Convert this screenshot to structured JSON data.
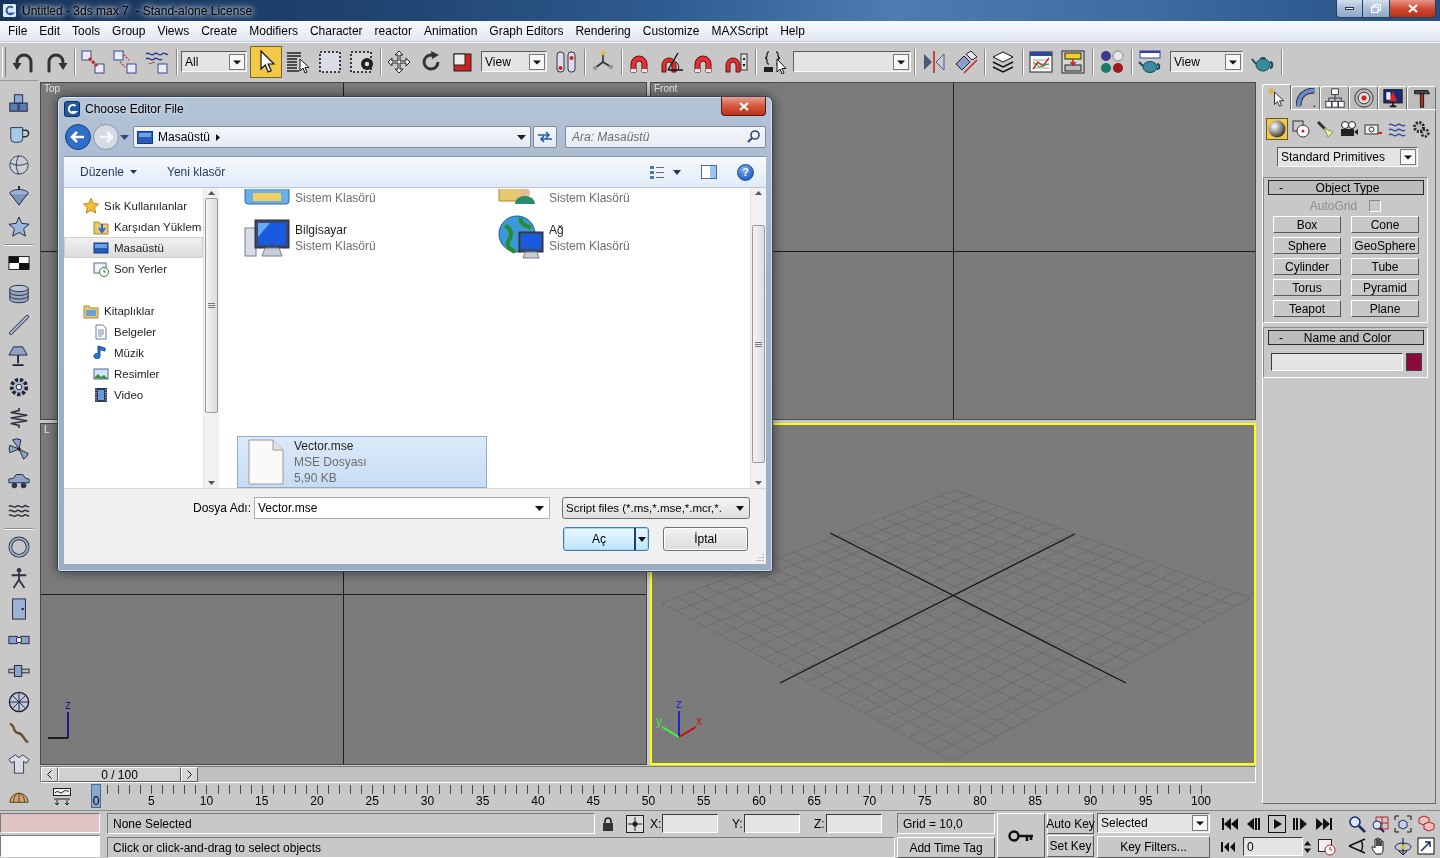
{
  "window": {
    "title": "Untitled - 3ds max 7  - Stand-alone License"
  },
  "menu": [
    "File",
    "Edit",
    "Tools",
    "Group",
    "Views",
    "Create",
    "Modifiers",
    "Character",
    "reactor",
    "Animation",
    "Graph Editors",
    "Rendering",
    "Customize",
    "MAXScript",
    "Help"
  ],
  "main_toolbar": {
    "selection_filter": "All",
    "select_object": {
      "active": true
    },
    "reference_coordinate_system": "View",
    "render_type": "View"
  },
  "viewports": [
    {
      "kind": "ortho",
      "label": "Top",
      "active": false
    },
    {
      "kind": "ortho",
      "label": "Front",
      "active": false
    },
    {
      "kind": "ortho",
      "label": "L",
      "active": false,
      "axes": [
        {
          "kind": "up",
          "label": "z",
          "color": "#1a1a8c"
        },
        {
          "kind": "left",
          "color": "#1e1e1e"
        }
      ]
    },
    {
      "kind": "perspective",
      "active": true,
      "axes": [
        {
          "kind": "up",
          "label": "z",
          "color": "#2222c8"
        },
        {
          "kind": "left",
          "label": "y",
          "color": "#3cf03c"
        },
        {
          "kind": "right",
          "label": "x",
          "color": "#c81414"
        }
      ]
    }
  ],
  "time_slider": {
    "label": "0 / 100",
    "level": 0
  },
  "track_bar": {
    "frames": [
      "0",
      "5",
      "10",
      "15",
      "20",
      "25",
      "30",
      "35",
      "40",
      "45",
      "50",
      "55",
      "60",
      "65",
      "70",
      "75",
      "80",
      "85",
      "90",
      "95",
      "100"
    ]
  },
  "command_panel": {
    "tabs": [
      {
        "selected": true
      },
      {
        "selected": false
      },
      {
        "selected": false
      },
      {
        "selected": false
      },
      {
        "selected": false
      },
      {
        "selected": false
      }
    ],
    "categories": [
      {
        "selected": true
      },
      {
        "selected": false
      },
      {
        "selected": false
      },
      {
        "selected": false
      },
      {
        "selected": false
      },
      {
        "selected": false
      },
      {
        "selected": false
      }
    ],
    "object_category": "Standard Primitives",
    "rollouts": [
      {
        "kind": "object_type",
        "title": "Object Type",
        "toggle": "-",
        "autogrid": {
          "label": "AutoGrid",
          "checked": false,
          "disabled": true
        },
        "buttons": [
          "Box",
          "Cone",
          "Sphere",
          "GeoSphere",
          "Cylinder",
          "Tube",
          "Torus",
          "Pyramid",
          "Teapot",
          "Plane"
        ]
      },
      {
        "kind": "name_color",
        "title": "Name and Color",
        "toggle": "-",
        "color": "#8a0a3c"
      }
    ]
  },
  "status_bar": {
    "selection": "None Selected",
    "coordinates": [
      "X:",
      "Y:",
      "Z:"
    ],
    "grid": "Grid = 10,0",
    "prompt": "Click or click-and-drag to select objects",
    "time_tag": "Add Time Tag",
    "auto_key": {
      "label": "Auto Key",
      "on": false
    },
    "set_key": "Set Key",
    "key_set": "Selected",
    "key_filters": "Key Filters...",
    "current_frame": "0"
  },
  "dialog": {
    "title": "Choose Editor File",
    "location": "Masaüstü",
    "search_placeholder": "Ara: Masaüstü",
    "commands": [
      {
        "label": "Düzenle",
        "menu": true
      },
      {
        "label": "Yeni klasör",
        "menu": false
      }
    ],
    "help": "?",
    "navigation": [
      {
        "label": "Sık Kullanılanlar",
        "kind": "favorites",
        "selected": false,
        "children": [
          {
            "label": "Karşıdan Yüklem",
            "kind": "downloads",
            "selected": false
          },
          {
            "label": "Masaüstü",
            "kind": "desktop",
            "selected": true
          },
          {
            "label": "Son Yerler",
            "kind": "recent",
            "selected": false
          }
        ]
      },
      {
        "label": "Kitaplıklar",
        "kind": "libraries",
        "selected": false,
        "children": [
          {
            "label": "Belgeler",
            "kind": "documents",
            "selected": false
          },
          {
            "label": "Müzik",
            "kind": "music",
            "selected": false
          },
          {
            "label": "Resimler",
            "kind": "pictures",
            "selected": false
          },
          {
            "label": "Video",
            "kind": "videos",
            "selected": false
          }
        ]
      }
    ],
    "file_groups": [
      {
        "items": [
          {
            "kind": "folder",
            "subtitle": "Sistem Klasörü",
            "selected": false
          },
          {
            "kind": "user-folder",
            "subtitle": "Sistem Klasörü",
            "selected": false
          },
          {
            "kind": "computer",
            "name": "Bilgisayar",
            "subtitle": "Sistem Klasörü",
            "selected": false
          },
          {
            "kind": "network",
            "name": "Ağ",
            "subtitle": "Sistem Klasörü",
            "selected": false
          }
        ]
      },
      {
        "items": [
          {
            "kind": "file",
            "name": "Vector.mse",
            "subtitle": "MSE Dosyası",
            "size": "5,90 KB",
            "selected": true
          }
        ]
      }
    ],
    "file_name_label": "Dosya Adı:",
    "file_name": "Vector.mse",
    "file_type": "Script files (*.ms,*.mse,*.mcr,*.",
    "buttons": [
      {
        "label": "Aç",
        "kind": "split",
        "default": true
      },
      {
        "label": "İptal",
        "kind": "plain",
        "default": false
      }
    ]
  }
}
